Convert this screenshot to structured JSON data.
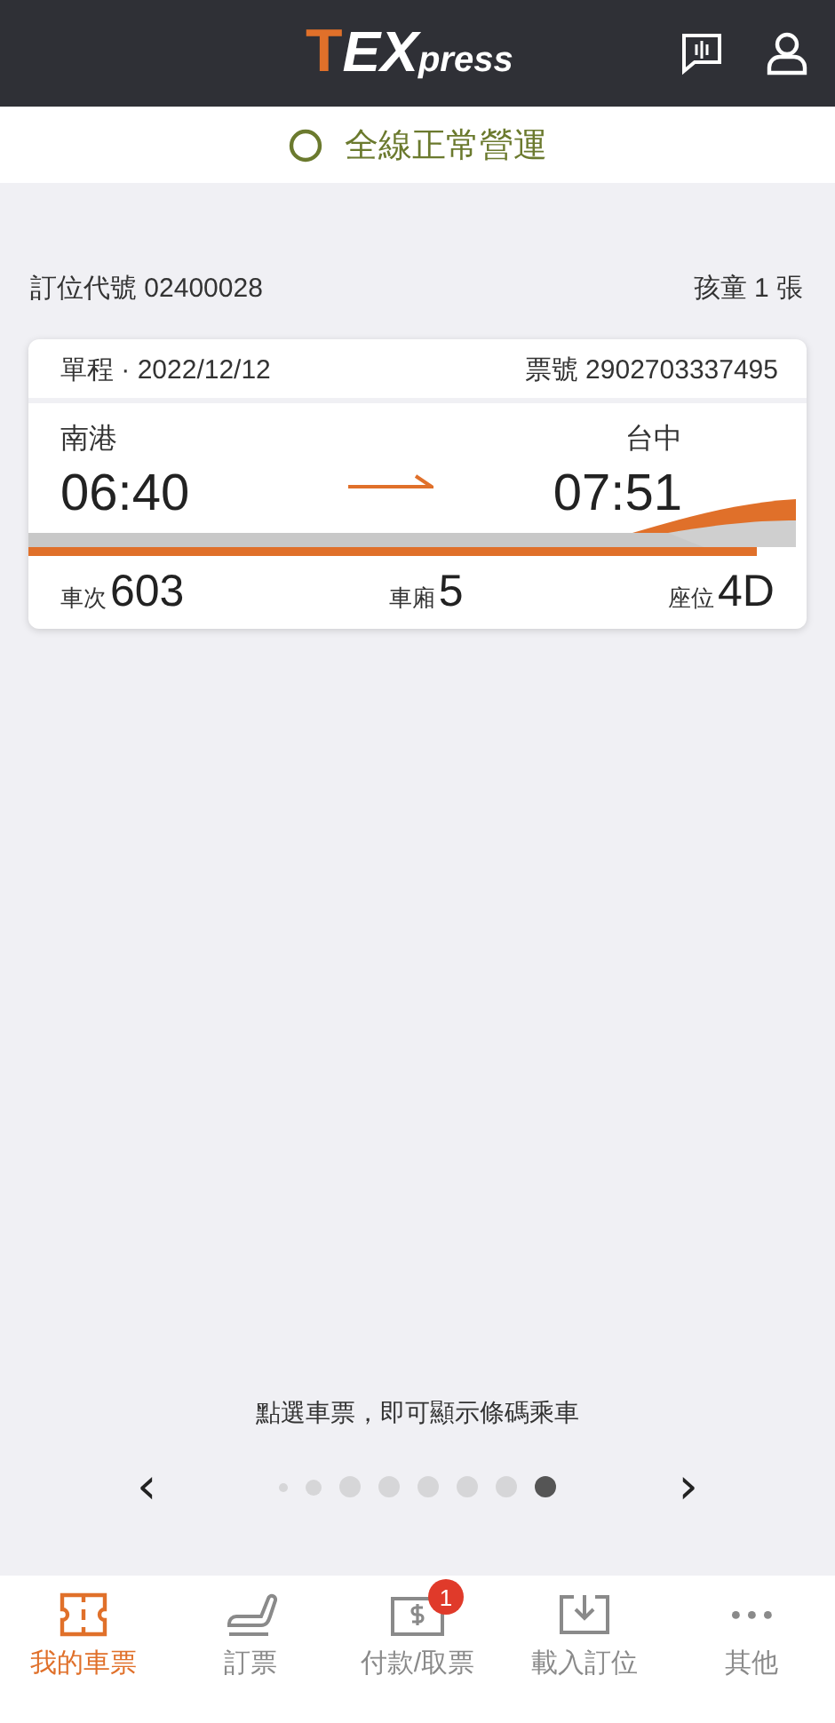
{
  "header": {
    "logo": [
      "T",
      "EX",
      "press"
    ]
  },
  "service_status": {
    "text": "全線正常營運"
  },
  "booking": {
    "code": "訂位代號 02400028",
    "tickets": "孩童 1 張"
  },
  "ticket": {
    "trip": "單程 · 2022/12/12",
    "ticket_number": "票號 2902703337495",
    "from_station": "南港",
    "from_time": "06:40",
    "to_station": "台中",
    "to_time": "07:51",
    "details": [
      {
        "label": "車次",
        "value": "603"
      },
      {
        "label": "車廂",
        "value": "5"
      },
      {
        "label": "座位",
        "value": "4D"
      }
    ]
  },
  "hint": "點選車票，即可顯示條碼乘車",
  "pager": {
    "dots": [
      {
        "kind": "tiny",
        "selected": false
      },
      {
        "kind": "small",
        "selected": false
      },
      {
        "kind": "normal",
        "selected": false
      },
      {
        "kind": "normal",
        "selected": false
      },
      {
        "kind": "normal",
        "selected": false
      },
      {
        "kind": "normal",
        "selected": false
      },
      {
        "kind": "normal",
        "selected": false
      },
      {
        "kind": "normal",
        "selected": true
      }
    ],
    "prev": "‹",
    "next": "›"
  },
  "tab_bar": [
    {
      "kind": "ticket",
      "label": "我的車票",
      "selected": true
    },
    {
      "kind": "seat",
      "label": "訂票",
      "selected": false
    },
    {
      "kind": "payment",
      "label": "付款/取票",
      "selected": false,
      "badge": "1"
    },
    {
      "kind": "import",
      "label": "載入訂位",
      "selected": false
    },
    {
      "kind": "more",
      "label": "其他",
      "selected": false
    }
  ]
}
